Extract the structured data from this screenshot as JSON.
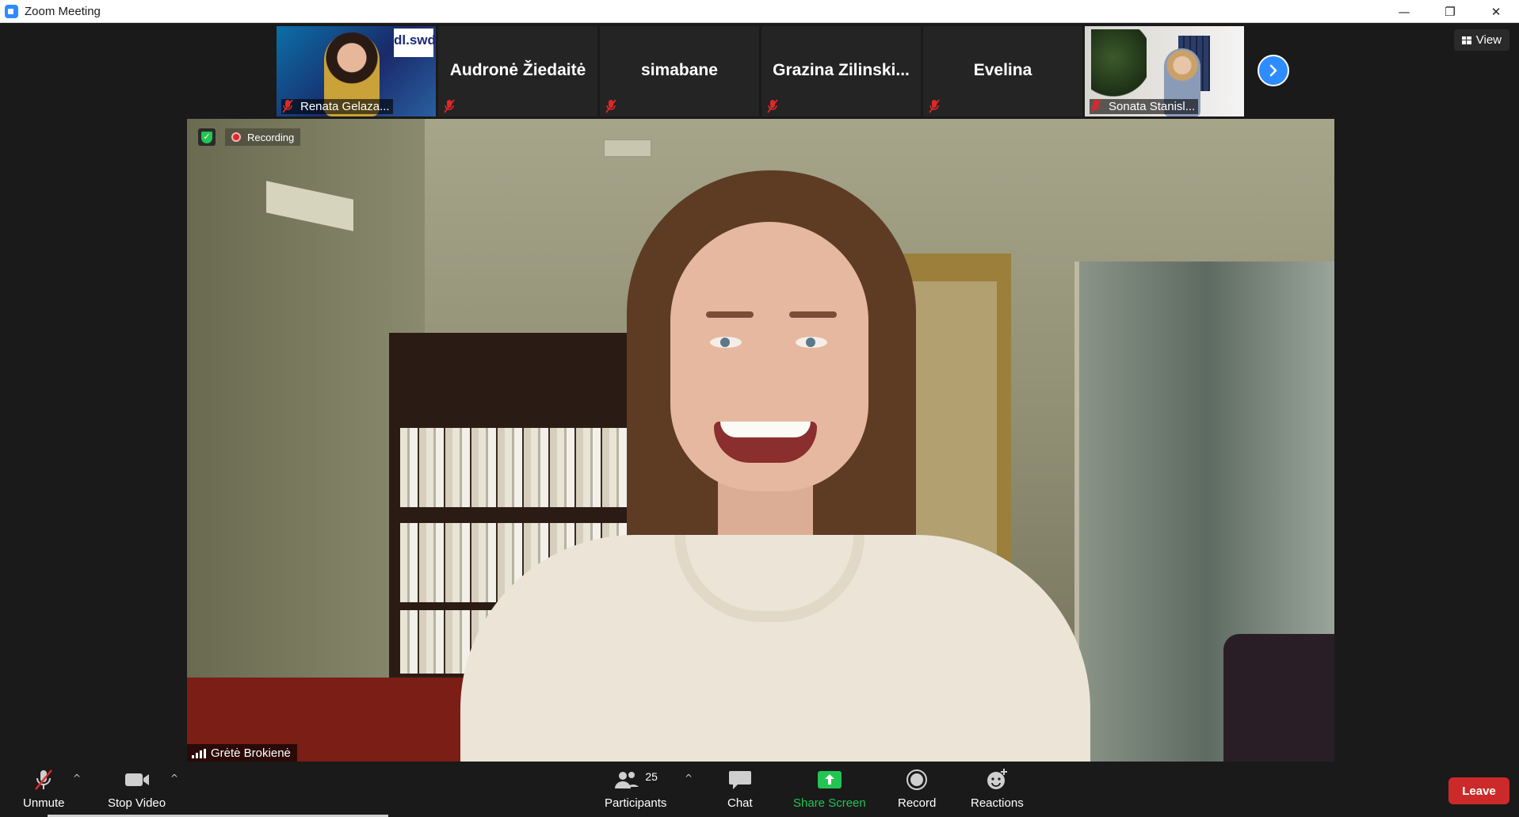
{
  "window": {
    "title": "Zoom Meeting",
    "controls": {
      "minimize": "—",
      "restore": "❐",
      "close": "✕"
    }
  },
  "gallery": {
    "participants": [
      {
        "name": "Renata Gelaza...",
        "type": "video",
        "logo_text": "dl.swd",
        "muted": true
      },
      {
        "name": "Audronė Žiedaitė",
        "type": "name",
        "muted": true
      },
      {
        "name": "simabane",
        "type": "name",
        "muted": true
      },
      {
        "name": "Grazina  Zilinski...",
        "type": "name",
        "muted": true
      },
      {
        "name": "Evelina",
        "type": "name",
        "muted": true
      },
      {
        "name": "Sonata Stanisl...",
        "type": "video",
        "muted": true
      }
    ],
    "next_icon": "chevron-right-icon",
    "view_label": "View"
  },
  "main_video": {
    "recording_label": "Recording",
    "speaker_name": "Grėtė Brokienė"
  },
  "toolbar": {
    "unmute_label": "Unmute",
    "stop_video_label": "Stop Video",
    "participants_label": "Participants",
    "participants_count": "25",
    "chat_label": "Chat",
    "share_screen_label": "Share Screen",
    "record_label": "Record",
    "reactions_label": "Reactions",
    "leave_label": "Leave"
  },
  "colors": {
    "accent": "#2d8cff",
    "share_green": "#23c552",
    "leave_red": "#cc2a2a",
    "mute_red": "#e02828"
  }
}
